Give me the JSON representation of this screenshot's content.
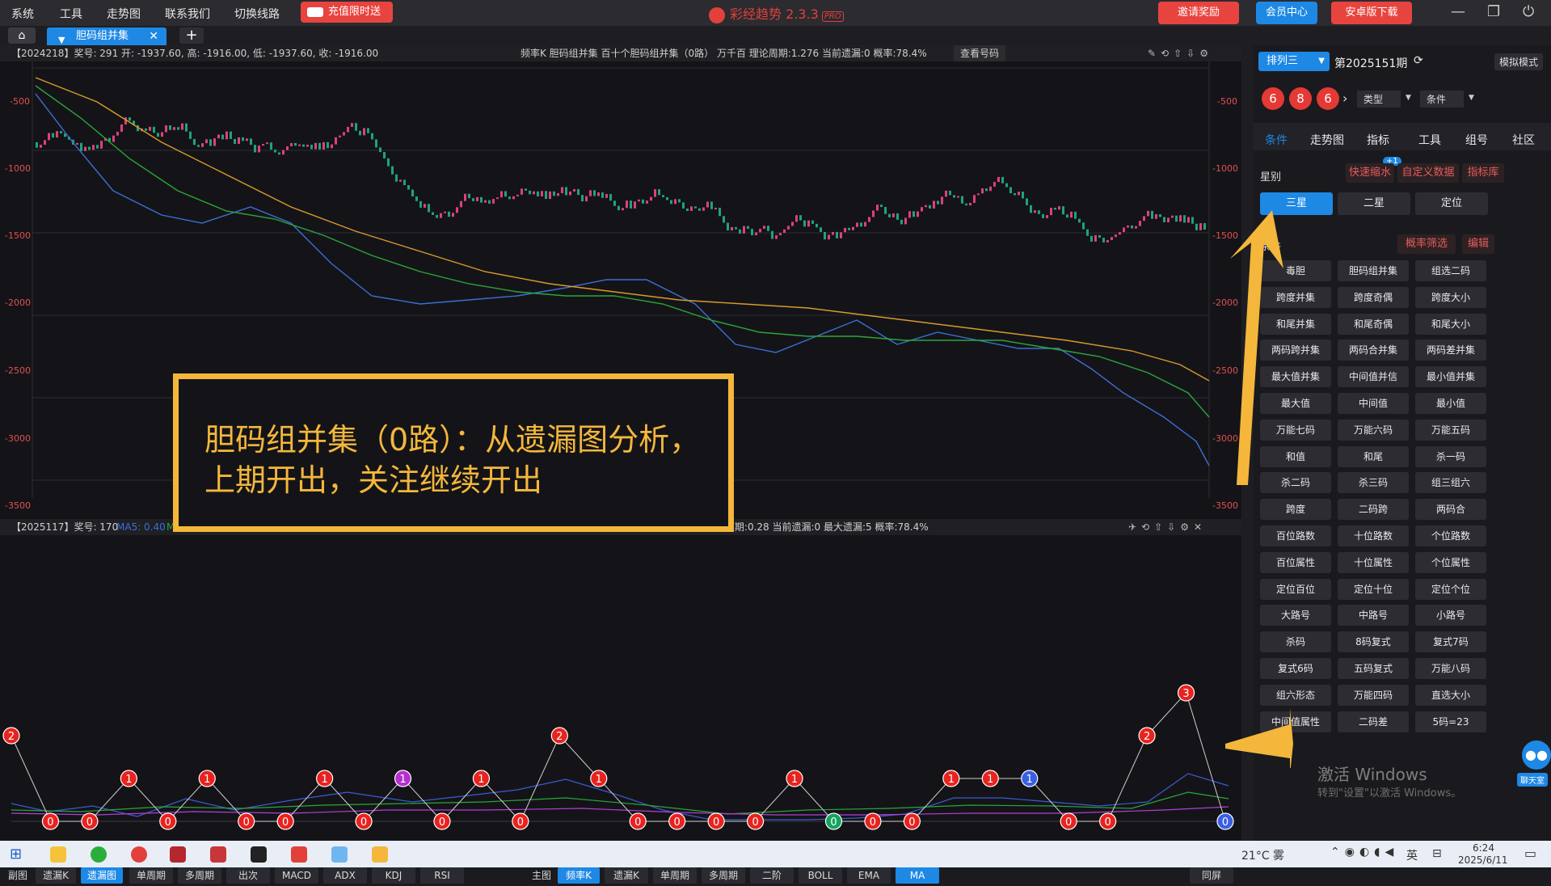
{
  "menu": [
    "系统",
    "工具",
    "走势图",
    "联系我们",
    "切换线路"
  ],
  "recharge_label": "充值限时送",
  "app_title": "彩经趋势 2.3.3",
  "app_badge": "PRO",
  "top_buttons": {
    "invite": "邀请奖励",
    "member": "会员中心",
    "android": "安卓版下载"
  },
  "win_controls": {
    "min": "—",
    "max": "❐",
    "power": "⏻"
  },
  "tabs": {
    "home": "⌂",
    "active": "胆码组并集",
    "close": "✕",
    "add": "+"
  },
  "top_info": {
    "left": "【2024218】奖号: 291  开: -1937.60, 高: -1916.00, 低: -1937.60, 收: -1916.00",
    "right": "频率K  胆码组并集  百十个胆码组并集（0路）  万千百  理论周期:1.276  当前遗漏:0  概率:78.4%",
    "btn": "查看号码"
  },
  "top_axis": [
    "-500",
    "-1000",
    "-1500",
    "-2000",
    "-2500",
    "-3000",
    "-3500"
  ],
  "bottom_info": {
    "left": "【2025117】奖号: 170",
    "ma5": "MA5: 0.40",
    "ma10": "MA10: 0.50",
    "ma20": "MA20: 0.40",
    "right": "遗漏图  胆码组并集  百十个胆码组并集（0路）  万千百  遗漏周期:0.28  当前遗漏:0  最大遗漏:5  概率:78.4%"
  },
  "annotation": {
    "line1": "胆码组并集（0路）：从遗漏图分析，",
    "line2": "上期开出，关注继续开出"
  },
  "omission_points": [
    2,
    0,
    0,
    1,
    0,
    1,
    0,
    0,
    1,
    0,
    1,
    0,
    1,
    0,
    2,
    1,
    0,
    0,
    0,
    0,
    1,
    0,
    0,
    0,
    1,
    1,
    1,
    0,
    0,
    2,
    3,
    0
  ],
  "point_colors": [
    "red",
    "red",
    "red",
    "red",
    "red",
    "red",
    "red",
    "red",
    "red",
    "red",
    "purple",
    "red",
    "red",
    "red",
    "red",
    "red",
    "red",
    "red",
    "red",
    "red",
    "red",
    "green",
    "red",
    "red",
    "red",
    "red",
    "blue",
    "red",
    "red",
    "red",
    "red",
    "blue"
  ],
  "bottom_toolbar": {
    "sub_label": "副图",
    "sub_buttons": [
      "遗漏K",
      "遗漏图",
      "单周期",
      "多周期",
      "出次",
      "MACD",
      "ADX",
      "KDJ",
      "RSI"
    ],
    "main_label": "主图",
    "main_buttons": [
      "频率K",
      "遗漏K",
      "单周期",
      "多周期",
      "二阶",
      "BOLL",
      "EMA",
      "MA"
    ],
    "same_screen": "同屏"
  },
  "side": {
    "lottery": "排列三",
    "period": "第2025151期",
    "mode": "模拟模式",
    "balls": [
      "6",
      "8",
      "6"
    ],
    "type_sel": "类型",
    "cond_sel": "条件",
    "tabs": [
      "条件",
      "走势图",
      "指标",
      "工具",
      "组号",
      "社区"
    ],
    "star_label": "星别",
    "plus1": "+1",
    "quick_btns": [
      "快速缩水",
      "自定义数据",
      "指标库"
    ],
    "stars": [
      "三星",
      "二星",
      "定位"
    ],
    "cond_label": "条件",
    "prob_filter": "概率筛选",
    "edit": "编辑",
    "conditions": [
      "毒胆",
      "胆码组并集",
      "组选二码",
      "跨度并集",
      "跨度奇偶",
      "跨度大小",
      "和尾并集",
      "和尾奇偶",
      "和尾大小",
      "两码跨并集",
      "两码合并集",
      "两码差并集",
      "最大值并集",
      "中间值并信",
      "最小值并集",
      "最大值",
      "中间值",
      "最小值",
      "万能七码",
      "万能六码",
      "万能五码",
      "和值",
      "和尾",
      "杀一码",
      "杀二码",
      "杀三码",
      "组三组六",
      "跨度",
      "二码跨",
      "两码合",
      "百位路数",
      "十位路数",
      "个位路数",
      "百位属性",
      "十位属性",
      "个位属性",
      "定位百位",
      "定位十位",
      "定位个位",
      "大路号",
      "中路号",
      "小路号",
      "杀码",
      "8码复式",
      "复式7码",
      "复式6码",
      "五码复式",
      "万能八码",
      "组六形态",
      "万能四码",
      "直选大小",
      "中间值属性",
      "二码差",
      "5码=23"
    ],
    "chat": "聊天室"
  },
  "watermark": {
    "line1": "激活 Windows",
    "line2": "转到\"设置\"以激活 Windows。"
  },
  "taskbar": {
    "weather": "21°C 雾",
    "ime": "英",
    "time": "6:24",
    "date": "2025/6/11"
  },
  "colors": {
    "accent": "#1e88e5",
    "red": "#e53935",
    "annotation": "#f4b73b"
  }
}
